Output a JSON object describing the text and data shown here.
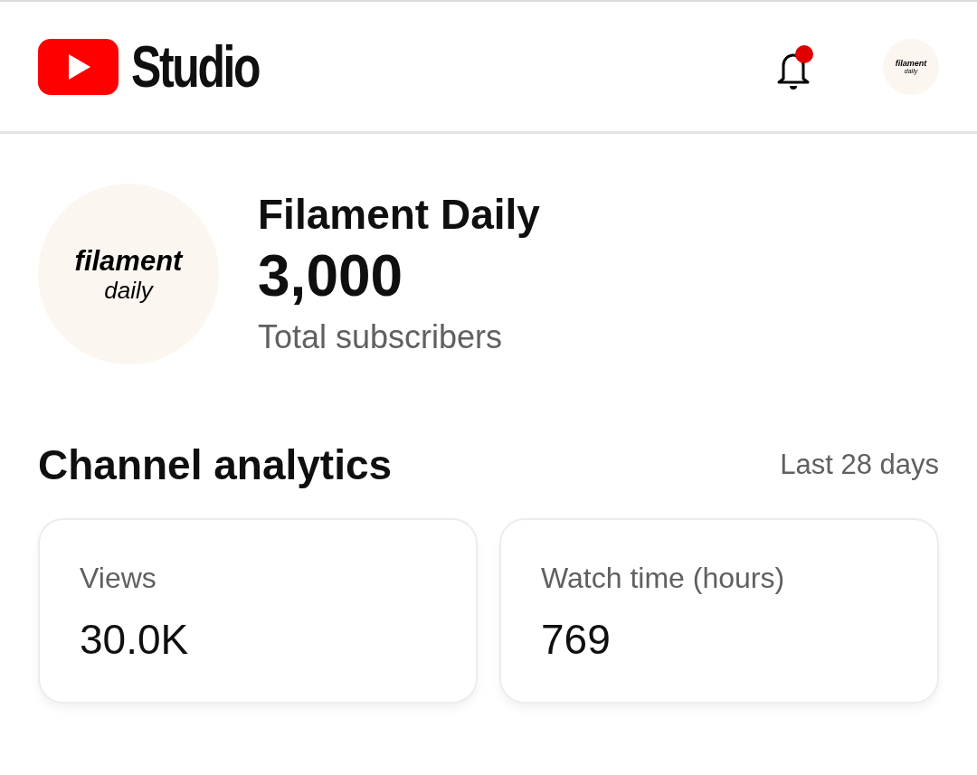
{
  "header": {
    "logo_text": "Studio",
    "notifications": {
      "unread": true
    },
    "avatar": {
      "lines": [
        "filament",
        "daily"
      ]
    }
  },
  "channel": {
    "avatar": {
      "lines": [
        "filament",
        "daily"
      ]
    },
    "name": "Filament Daily",
    "subscribers": "3,000",
    "subscribers_label": "Total subscribers"
  },
  "analytics": {
    "title": "Channel analytics",
    "period": "Last 28 days",
    "cards": [
      {
        "label": "Views",
        "value": "30.0K"
      },
      {
        "label": "Watch time (hours)",
        "value": "769"
      }
    ]
  }
}
